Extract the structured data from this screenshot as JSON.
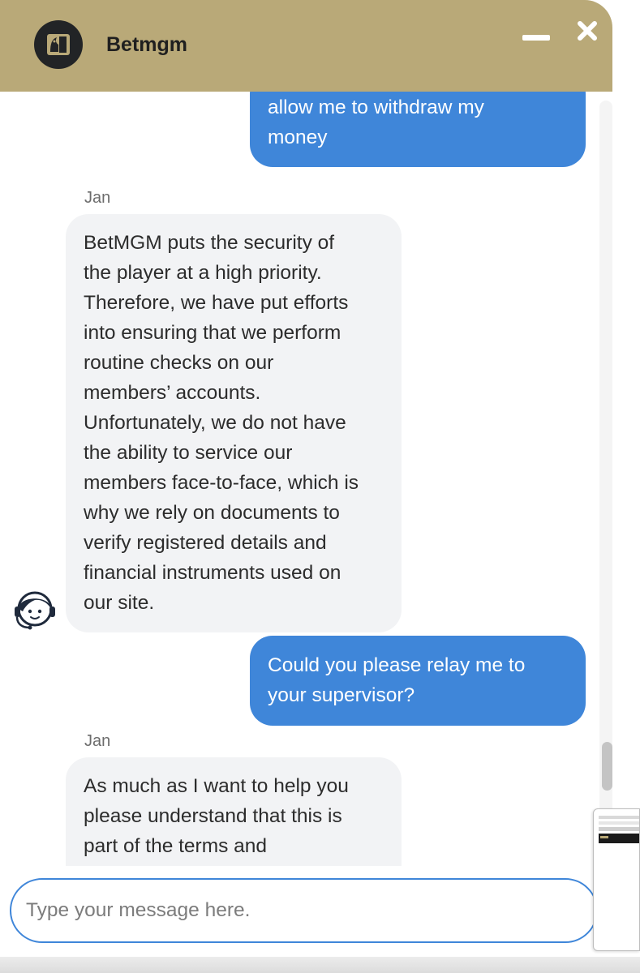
{
  "header": {
    "brand_name": "Betmgm",
    "logo_icon": "lion-icon",
    "minimize_icon": "minimize-icon",
    "close_icon": "close-icon",
    "background_color": "#b9a978"
  },
  "messages": [
    {
      "sender": "user",
      "text_lines": [
        "allow me to withdraw my",
        "money"
      ]
    },
    {
      "sender": "agent",
      "name": "Jan",
      "text_lines": [
        "BetMGM puts the security of",
        "the player at a high priority.",
        "Therefore, we have put efforts",
        "into ensuring that we perform",
        "routine checks on our",
        "members’ accounts.",
        "Unfortunately, we do not have",
        "the ability to service our",
        "members face-to-face, which is",
        "why we rely on documents to",
        "verify registered details and",
        "financial instruments used on",
        "our site."
      ]
    },
    {
      "sender": "user",
      "text_lines": [
        "Could you please relay me to",
        "your supervisor?"
      ]
    },
    {
      "sender": "agent",
      "name": "Jan",
      "text_lines": [
        "As much as I want to help you",
        "please understand that this is",
        "part of the terms and"
      ]
    }
  ],
  "agent_avatar_icon": "support-agent-headset-icon",
  "composer": {
    "placeholder": "Type your message here.",
    "value": ""
  },
  "colors": {
    "user_bubble": "#3f86d9",
    "agent_bubble": "#f2f3f5",
    "input_border": "#3f86d9"
  }
}
